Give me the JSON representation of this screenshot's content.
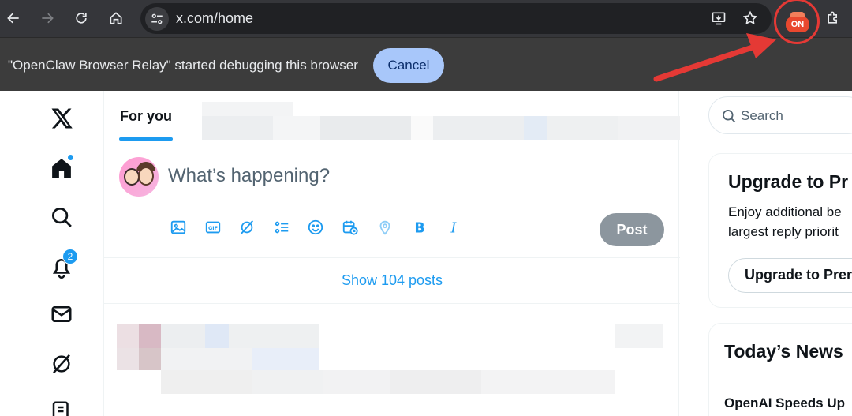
{
  "browser": {
    "url": "x.com/home",
    "extension_badge": "ON",
    "infobar": {
      "message": "\"OpenClaw Browser Relay\" started debugging this browser",
      "cancel_label": "Cancel"
    }
  },
  "x": {
    "tabs": {
      "for_you": "For you"
    },
    "composer": {
      "placeholder": "What’s happening?",
      "post_label": "Post"
    },
    "show_posts": "Show 104 posts",
    "notifications_count": "2",
    "search_placeholder": "Search",
    "premium_card": {
      "title": "Upgrade to Pr",
      "line1": "Enjoy additional be",
      "line2": "largest reply priorit",
      "button": "Upgrade to Prer"
    },
    "news_card": {
      "title": "Today’s News",
      "headline": "OpenAI Speeds Up"
    }
  },
  "colors": {
    "accent": "#1d9bf0",
    "annotation": "#e53935",
    "cancel_bg": "#a8c7fa"
  }
}
